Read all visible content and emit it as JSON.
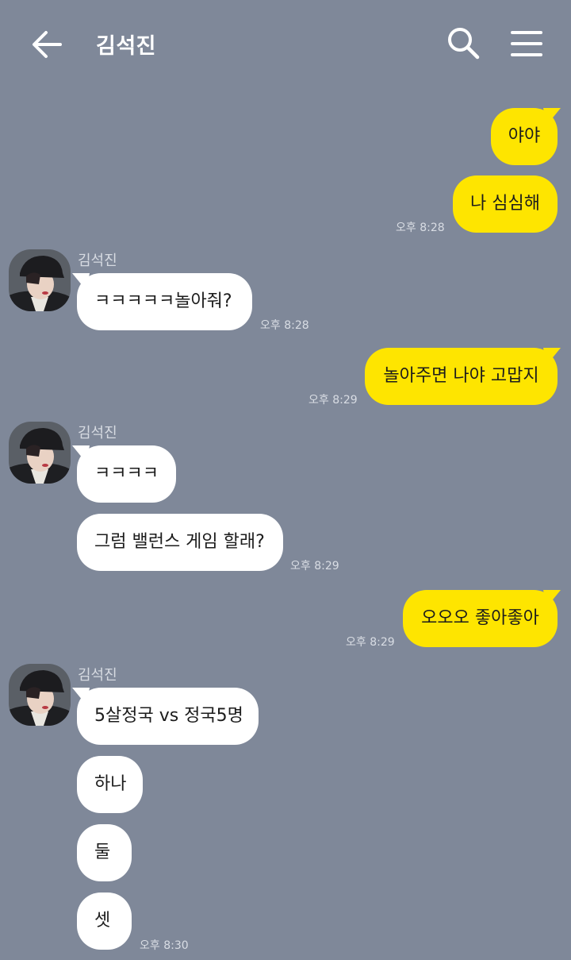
{
  "header": {
    "title": "김석진"
  },
  "contact_name": "김석진",
  "messages": [
    {
      "text": "야야"
    },
    {
      "text": "나 심심해",
      "time": "오후 8:28"
    },
    {
      "text": "ㅋㅋㅋㅋㅋ놀아줘?",
      "time": "오후 8:28"
    },
    {
      "text": "놀아주면 나야 고맙지",
      "time": "오후 8:29"
    },
    {
      "text": "ㅋㅋㅋㅋ"
    },
    {
      "text": "그럼 밸런스 게임 할래?",
      "time": "오후 8:29"
    },
    {
      "text": "오오오 좋아좋아",
      "time": "오후 8:29"
    },
    {
      "text": "5살정국 vs 정국5명"
    },
    {
      "text": "하나"
    },
    {
      "text": "둘"
    },
    {
      "text": "셋",
      "time": "오후 8:30"
    }
  ],
  "colors": {
    "background": "#7f8899",
    "my_bubble": "#fee500",
    "their_bubble": "#ffffff"
  }
}
